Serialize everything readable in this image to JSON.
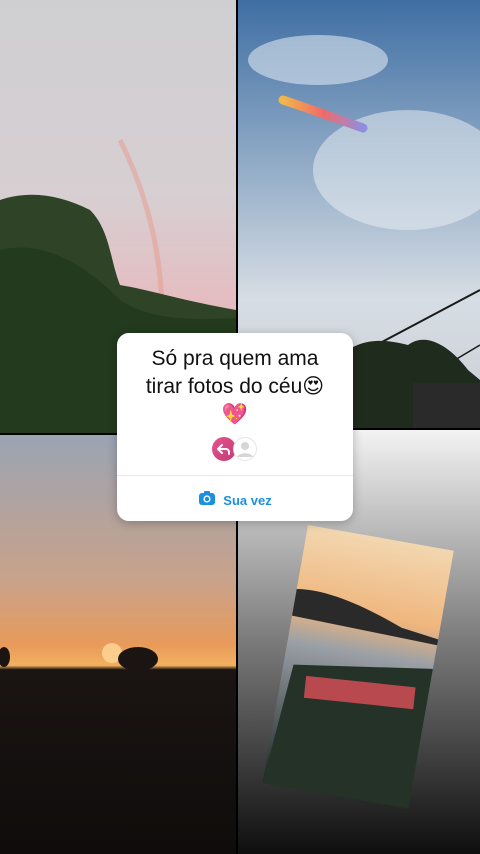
{
  "question_sticker": {
    "line1": "Só pra quem ama",
    "line2": "tirar fotos do céu😍",
    "line3": "💖",
    "cta_label": "Sua vez"
  },
  "colors": {
    "accent": "#1b8fe0",
    "reply_icon": "#d9477f"
  },
  "icons": {
    "reply": "reply-arrow-icon",
    "avatar": "avatar-placeholder-icon",
    "camera": "camera-icon"
  }
}
